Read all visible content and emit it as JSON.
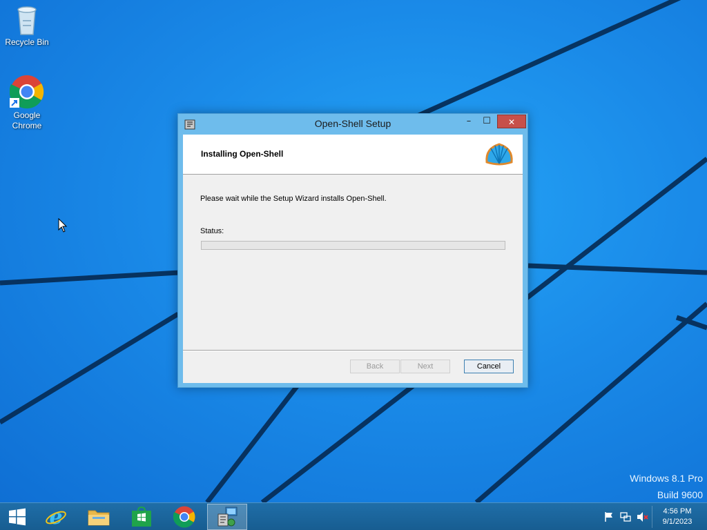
{
  "desktop": {
    "icons": [
      {
        "label": "Recycle Bin",
        "icon": "recycle-bin-icon"
      },
      {
        "label": "Google Chrome",
        "icon": "chrome-icon"
      }
    ],
    "watermark": {
      "edition": "Windows 8.1 Pro",
      "build": "Build 9600"
    }
  },
  "window": {
    "title": "Open-Shell Setup",
    "controls": {
      "minimize": "–",
      "maximize": "☐",
      "close": "✕"
    },
    "banner_heading": "Installing Open-Shell",
    "message": "Please wait while the Setup Wizard installs Open-Shell.",
    "status_label": "Status:",
    "progress": 0,
    "buttons": {
      "back": "Back",
      "next": "Next",
      "cancel": "Cancel"
    }
  },
  "taskbar": {
    "items": [
      {
        "icon": "windows-start-icon",
        "active": false
      },
      {
        "icon": "internet-explorer-icon",
        "active": false
      },
      {
        "icon": "file-explorer-icon",
        "active": false
      },
      {
        "icon": "windows-store-icon",
        "active": false
      },
      {
        "icon": "chrome-icon",
        "active": false
      },
      {
        "icon": "setup-installer-icon",
        "active": true
      }
    ],
    "tray": {
      "time": "4:56 PM",
      "date": "9/1/2023"
    }
  },
  "colors": {
    "desktop_blue": "#1a8ae8",
    "taskbar": "#1b66a0",
    "window_frame": "#6ebcec",
    "close_button": "#c7504a"
  }
}
